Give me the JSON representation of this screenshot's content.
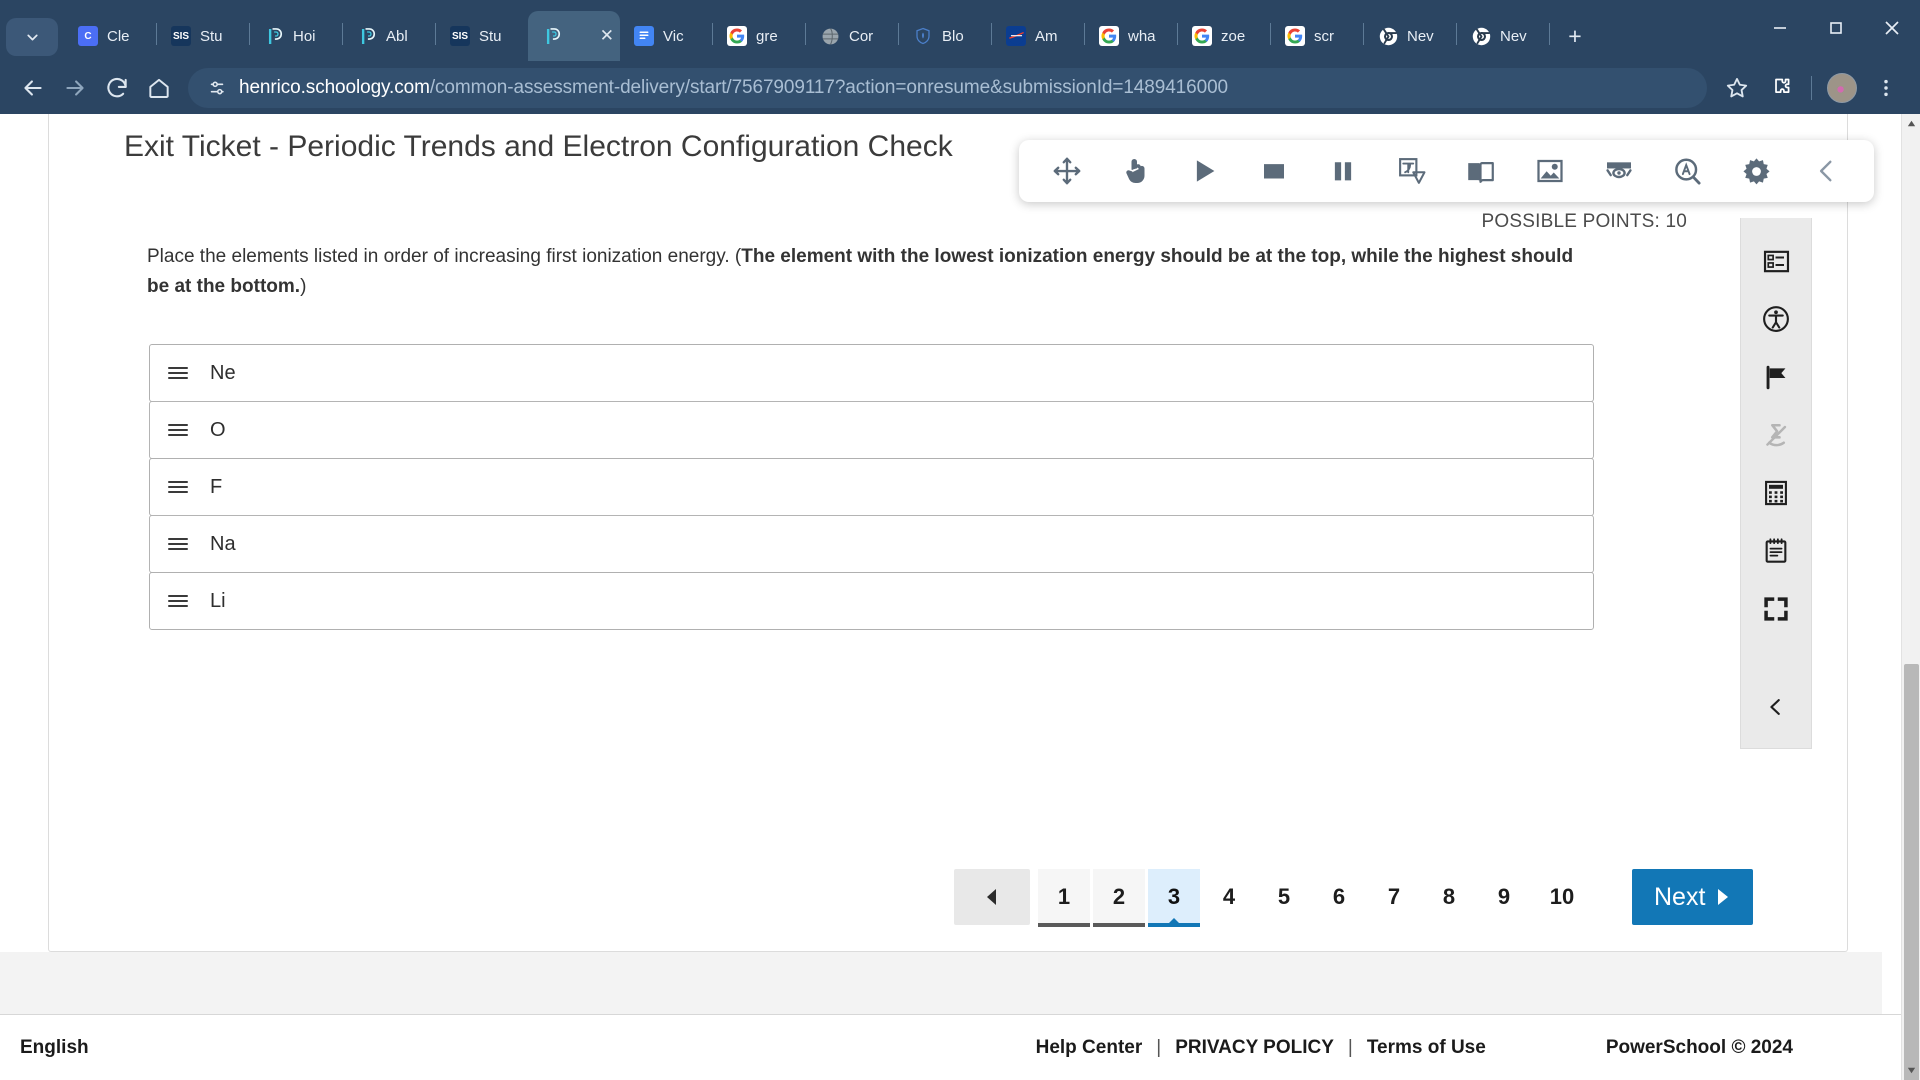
{
  "browser": {
    "tab_search_icon": "chevron-down-icon",
    "tabs": [
      {
        "label": "Cle",
        "favicon": "clever-icon",
        "fav_text": "C",
        "fav_class": "fav-clever",
        "active": false
      },
      {
        "label": "Stu",
        "favicon": "sis-icon",
        "fav_text": "SIS",
        "fav_class": "fav-sis",
        "active": false
      },
      {
        "label": "Hoi",
        "favicon": "powerschool-icon",
        "fav_text": "P",
        "fav_class": "fav-ps",
        "active": false
      },
      {
        "label": "Abl",
        "favicon": "powerschool-icon",
        "fav_text": "P",
        "fav_class": "fav-ps",
        "active": false
      },
      {
        "label": "Stu",
        "favicon": "sis-icon",
        "fav_text": "SIS",
        "fav_class": "fav-sis",
        "active": false
      },
      {
        "label": "",
        "favicon": "powerschool-icon",
        "fav_text": "P",
        "fav_class": "fav-ps",
        "active": true
      },
      {
        "label": "Vic",
        "favicon": "google-docs-icon",
        "fav_text": "",
        "fav_class": "fav-docs",
        "active": false
      },
      {
        "label": "gre",
        "favicon": "google-icon",
        "fav_text": "G",
        "fav_class": "fav-google",
        "active": false
      },
      {
        "label": "Cor",
        "favicon": "globe-icon",
        "fav_text": "",
        "fav_class": "fav-globe",
        "active": false
      },
      {
        "label": "Blo",
        "favicon": "shield-icon",
        "fav_text": "",
        "fav_class": "fav-shield",
        "active": false
      },
      {
        "label": "Am",
        "favicon": "nasa-icon",
        "fav_text": "",
        "fav_class": "fav-nasa",
        "active": false
      },
      {
        "label": "wha",
        "favicon": "google-icon",
        "fav_text": "G",
        "fav_class": "fav-google",
        "active": false
      },
      {
        "label": "zoe",
        "favicon": "google-icon",
        "fav_text": "G",
        "fav_class": "fav-google",
        "active": false
      },
      {
        "label": "scr",
        "favicon": "google-icon",
        "fav_text": "G",
        "fav_class": "fav-google",
        "active": false
      },
      {
        "label": "Nev",
        "favicon": "chrome-icon",
        "fav_text": "",
        "fav_class": "fav-chrome",
        "active": false
      },
      {
        "label": "Nev",
        "favicon": "chrome-icon",
        "fav_text": "",
        "fav_class": "fav-chrome",
        "active": false
      }
    ],
    "new_tab_label": "+",
    "close_tab_label": "✕",
    "window_controls": {
      "minimize": "—",
      "maximize": "□",
      "close": "✕"
    },
    "nav": {
      "back": "back-icon",
      "forward": "forward-icon",
      "reload": "reload-icon",
      "home": "home-icon"
    },
    "omnibox": {
      "site_icon": "site-settings-icon",
      "url_domain": "henrico.schoology.com",
      "url_path": "/common-assessment-delivery/start/7567909117?action=onresume&submissionId=1489416000"
    },
    "actions": {
      "bookmark": "star-icon",
      "extensions": "puzzle-icon",
      "profile": "avatar",
      "menu": "three-dot-menu-icon"
    }
  },
  "float_toolbar": {
    "buttons": [
      {
        "name": "move-toolbar-handle",
        "icon": "move-icon"
      },
      {
        "name": "pointer-tool-button",
        "icon": "hand-pointer-icon"
      },
      {
        "name": "play-button",
        "icon": "play-icon"
      },
      {
        "name": "stop-button",
        "icon": "stop-icon"
      },
      {
        "name": "pause-button",
        "icon": "pause-icon"
      },
      {
        "name": "translate-button",
        "icon": "translate-icon"
      },
      {
        "name": "dictionary-button",
        "icon": "book-icon"
      },
      {
        "name": "picture-dictionary-button",
        "icon": "image-icon"
      },
      {
        "name": "reading-mask-button",
        "icon": "reading-mask-icon"
      },
      {
        "name": "screen-magnifier-button",
        "icon": "magnifier-a-icon"
      },
      {
        "name": "settings-button",
        "icon": "gear-icon"
      },
      {
        "name": "collapse-toolbar-button",
        "icon": "chevron-left-icon"
      }
    ]
  },
  "assessment": {
    "title": "Exit Ticket - Periodic Trends and Electron Configuration Check",
    "possible_points_label": "POSSIBLE POINTS: 10",
    "question_plain": "Place the elements listed in order of increasing first ionization energy.  (",
    "question_bold": "The element with the lowest ionization energy should be at the top, while the highest should be at the bottom.",
    "question_tail": ")",
    "sort_items": [
      {
        "label": "Ne",
        "handle": "drag-handle-icon"
      },
      {
        "label": "O",
        "handle": "drag-handle-icon"
      },
      {
        "label": "F",
        "handle": "drag-handle-icon"
      },
      {
        "label": "Na",
        "handle": "drag-handle-icon"
      },
      {
        "label": "Li",
        "handle": "drag-handle-icon"
      }
    ]
  },
  "pagination": {
    "prev_icon": "triangle-left-icon",
    "pages": [
      {
        "label": "1",
        "state": "visited"
      },
      {
        "label": "2",
        "state": "visited"
      },
      {
        "label": "3",
        "state": "current"
      },
      {
        "label": "4",
        "state": "unvisited"
      },
      {
        "label": "5",
        "state": "unvisited"
      },
      {
        "label": "6",
        "state": "unvisited"
      },
      {
        "label": "7",
        "state": "unvisited"
      },
      {
        "label": "8",
        "state": "unvisited"
      },
      {
        "label": "9",
        "state": "unvisited"
      },
      {
        "label": "10",
        "state": "unvisited"
      }
    ],
    "next_label": "Next",
    "next_icon": "triangle-right-icon",
    "accent_color": "#1277b6"
  },
  "rail": {
    "buttons": [
      {
        "name": "question-list-button",
        "icon": "question-list-icon",
        "disabled": false
      },
      {
        "name": "accessibility-button",
        "icon": "accessibility-icon",
        "disabled": false
      },
      {
        "name": "flag-question-button",
        "icon": "flag-icon",
        "disabled": false
      },
      {
        "name": "highlighter-button",
        "icon": "highlighter-off-icon",
        "disabled": true
      },
      {
        "name": "calculator-button",
        "icon": "calculator-icon",
        "disabled": false
      },
      {
        "name": "notepad-button",
        "icon": "notepad-icon",
        "disabled": false
      },
      {
        "name": "fullscreen-button",
        "icon": "fullscreen-icon",
        "disabled": false
      },
      {
        "name": "collapse-rail-button",
        "icon": "chevron-left-icon",
        "disabled": false
      }
    ]
  },
  "footer": {
    "language": "English",
    "help_center": "Help Center",
    "sep1": "|",
    "privacy_policy": "PRIVACY POLICY",
    "sep2": "|",
    "terms_of_use": "Terms of Use",
    "copyright": "PowerSchool © 2024"
  }
}
